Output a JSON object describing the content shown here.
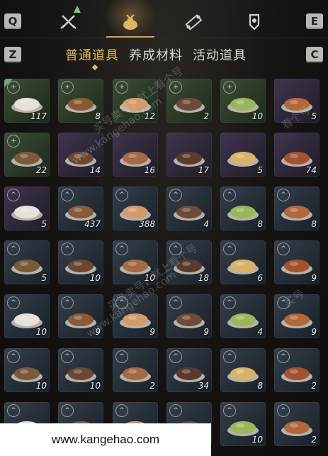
{
  "nav": {
    "left_key": "Q",
    "right_key": "E",
    "tabs": [
      {
        "name": "equipment-tab",
        "icon": "crossed-swords-icon"
      },
      {
        "name": "items-tab",
        "icon": "pouch-icon"
      },
      {
        "name": "scroll-tab",
        "icon": "scroll-icon"
      },
      {
        "name": "rank-tab",
        "icon": "badge-rank-icon"
      }
    ]
  },
  "subnav": {
    "left_key": "Z",
    "right_key": "C",
    "tabs": [
      "普通道具",
      "养成材料",
      "活动道具"
    ],
    "active_index": 0
  },
  "items": [
    {
      "count": "117",
      "rarity": "green",
      "badge": "+"
    },
    {
      "count": "8",
      "rarity": "green",
      "badge": "+"
    },
    {
      "count": "12",
      "rarity": "green",
      "badge": "+"
    },
    {
      "count": "2",
      "rarity": "green",
      "badge": "+"
    },
    {
      "count": "10",
      "rarity": "green",
      "badge": "+"
    },
    {
      "count": "5",
      "rarity": "purple",
      "badge": ""
    },
    {
      "count": "22",
      "rarity": "green",
      "badge": "+"
    },
    {
      "count": "14",
      "rarity": "purple",
      "badge": ""
    },
    {
      "count": "16",
      "rarity": "purple",
      "badge": ""
    },
    {
      "count": "17",
      "rarity": "purple",
      "badge": ""
    },
    {
      "count": "5",
      "rarity": "purple",
      "badge": ""
    },
    {
      "count": "74",
      "rarity": "purple",
      "badge": ""
    },
    {
      "count": "5",
      "rarity": "purple",
      "badge": "^"
    },
    {
      "count": "437",
      "rarity": "blue",
      "badge": "^"
    },
    {
      "count": "388",
      "rarity": "blue",
      "badge": "^"
    },
    {
      "count": "4",
      "rarity": "blue",
      "badge": "^"
    },
    {
      "count": "8",
      "rarity": "blue",
      "badge": "^"
    },
    {
      "count": "8",
      "rarity": "blue",
      "badge": "^"
    },
    {
      "count": "5",
      "rarity": "blue",
      "badge": "^"
    },
    {
      "count": "10",
      "rarity": "blue",
      "badge": "^"
    },
    {
      "count": "10",
      "rarity": "blue",
      "badge": "^"
    },
    {
      "count": "18",
      "rarity": "blue",
      "badge": "^"
    },
    {
      "count": "6",
      "rarity": "blue",
      "badge": "^"
    },
    {
      "count": "9",
      "rarity": "blue",
      "badge": "^"
    },
    {
      "count": "10",
      "rarity": "blue",
      "badge": "^"
    },
    {
      "count": "9",
      "rarity": "blue",
      "badge": "^"
    },
    {
      "count": "9",
      "rarity": "blue",
      "badge": "^"
    },
    {
      "count": "9",
      "rarity": "blue",
      "badge": "^"
    },
    {
      "count": "4",
      "rarity": "blue",
      "badge": "^"
    },
    {
      "count": "9",
      "rarity": "blue",
      "badge": "^"
    },
    {
      "count": "10",
      "rarity": "blue",
      "badge": "^"
    },
    {
      "count": "10",
      "rarity": "blue",
      "badge": "^"
    },
    {
      "count": "2",
      "rarity": "blue",
      "badge": "^"
    },
    {
      "count": "34",
      "rarity": "blue",
      "badge": "^"
    },
    {
      "count": "8",
      "rarity": "blue",
      "badge": "^"
    },
    {
      "count": "2",
      "rarity": "blue",
      "badge": "^"
    },
    {
      "count": "",
      "rarity": "blue",
      "badge": "^"
    },
    {
      "count": "",
      "rarity": "blue",
      "badge": "^"
    },
    {
      "count": "",
      "rarity": "blue",
      "badge": "^"
    },
    {
      "count": "",
      "rarity": "blue",
      "badge": "^"
    },
    {
      "count": "10",
      "rarity": "blue",
      "badge": "^"
    },
    {
      "count": "2",
      "rarity": "blue",
      "badge": "^"
    }
  ],
  "watermarks": [
    "买号卖号，就上看个号",
    "www.kangehao.com",
    "买号卖号，就上看个号",
    "www.kangehao.com",
    "看个号",
    "买号"
  ],
  "banner": {
    "text": "www.kangehao.com"
  },
  "colors": {
    "accent": "#e2b560",
    "green": "#3d4d35",
    "purple": "#40344f",
    "blue": "#34404c"
  }
}
